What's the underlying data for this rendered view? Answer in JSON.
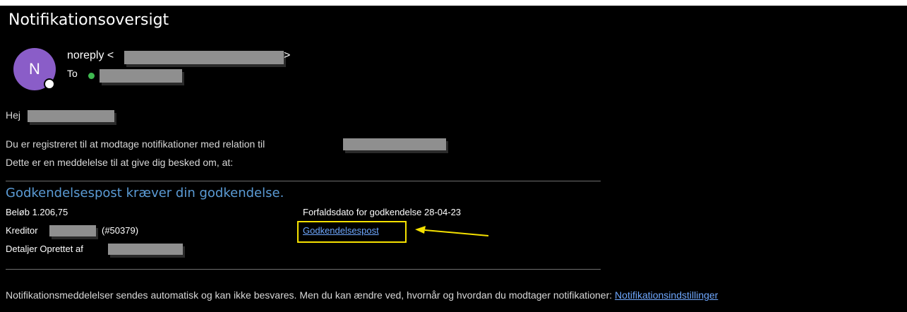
{
  "header": {
    "subject": "Notifikationsoversigt"
  },
  "sender": {
    "avatar_initial": "N",
    "name_prefix": "noreply <",
    "name_suffix": ">",
    "to_label": "To"
  },
  "body": {
    "greeting": "Hej",
    "registered_line": "Du er registreret til at modtage notifikationer med relation til",
    "message_line": "Dette er en meddelelse til at give dig besked om, at:",
    "heading": "Godkendelsespost  kræver din godkendelse.",
    "amount": "Beløb 1.206,75",
    "creditor_label": "Kreditor",
    "creditor_id": "(#50379)",
    "details_label": "Detaljer Oprettet af",
    "due_date": "Forfaldsdato for godkendelse 28-04-23",
    "approval_link": "Godkendelsespost"
  },
  "footer": {
    "text": "Notifikationsmeddelelser sendes automatisk og kan ikke besvares. Men du kan ændre ved, hvornår og hvordan du modtager notifikationer:",
    "settings_link": "Notifikationsindstillinger"
  },
  "colors": {
    "background": "#000000",
    "avatar": "#8a5dc8",
    "heading": "#5b9bd5",
    "link": "#6fa8ff",
    "highlight": "#f5e100",
    "redaction": "#8f8f8f",
    "verified": "#3fb950"
  },
  "icons": [
    "verified-icon",
    "presence-icon",
    "annotation-arrow-icon"
  ]
}
